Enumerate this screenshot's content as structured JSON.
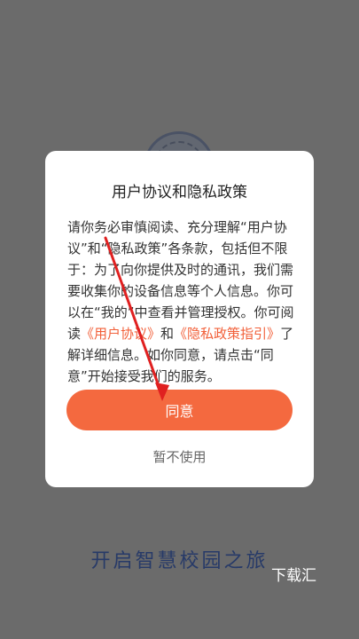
{
  "splash": {
    "slogan": "开启智慧校园之旅",
    "watermark": "下载汇"
  },
  "dialog": {
    "title": "用户协议和隐私政策",
    "body_part1": "请你务必审慎阅读、充分理解“用户协议”和“隐私政策”各条款，包括但不限于：为了向你提供及时的通讯，我们需要收集你的设备信息等个人信息。你可以在“我的”中查看并管理授权。你可阅读",
    "user_agreement_link": "《用户协议》",
    "connector": "和",
    "privacy_link": "《隐私政策指引》",
    "body_part2": "了解详细信息。如你同意，请点击“同意”开始接受我们的服务。",
    "agree_label": "同意",
    "decline_label": "暂不使用"
  },
  "colors": {
    "accent": "#f4693f",
    "link": "#f2603a",
    "overlay": "#6b6b6b",
    "slogan": "#273a68",
    "annotation": "#e02020"
  },
  "icons": {
    "logo": "school-seal-icon",
    "annotation": "red-arrow-icon"
  }
}
